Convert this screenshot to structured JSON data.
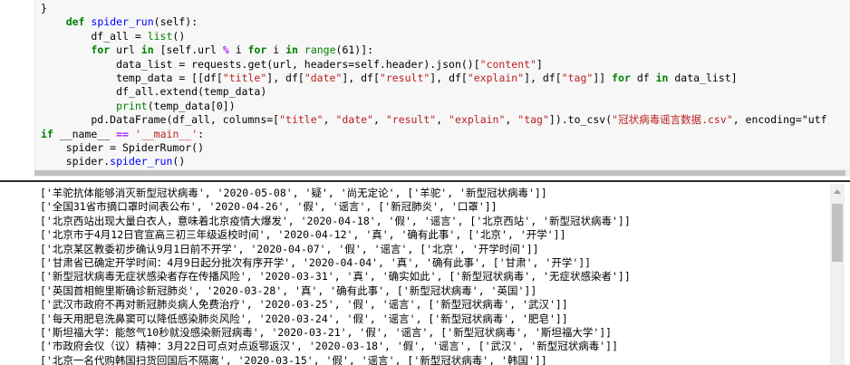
{
  "code": {
    "lines": [
      "}",
      "    def spider_run(self):",
      "        df_all = list()",
      "        for url in [self.url % i for i in range(61)]:",
      "            data_list = requests.get(url, headers=self.header).json()[\"content\"]",
      "            temp_data = [[df[\"title\"], df[\"date\"], df[\"result\"], df[\"explain\"], df[\"tag\"]] for df in data_list]",
      "            df_all.extend(temp_data)",
      "            print(temp_data[0])",
      "        pd.DataFrame(df_all, columns=[\"title\", \"date\", \"result\", \"explain\", \"tag\"]).to_csv(\"冠状病毒谣言数据.csv\", encoding=\"utf",
      "if __name__ == '__main__':",
      "    spider = SpiderRumor()",
      "    spider.spider_run()"
    ]
  },
  "output": {
    "lines": [
      "['羊驼抗体能够消灭新型冠状病毒', '2020-05-08', '疑', '尚无定论', ['羊驼', '新型冠状病毒']]",
      "['全国31省市摘口罩时间表公布', '2020-04-26', '假', '谣言', ['新冠肺炎', '口罩']]",
      "['北京西站出现大量白衣人，意味着北京疫情大爆发', '2020-04-18', '假', '谣言', ['北京西站', '新型冠状病毒']]",
      "['北京市于4月12日官宣高三初三年级返校时间', '2020-04-12', '真', '确有此事', ['北京', '开学']]",
      "['北京某区教委初步确认9月1日前不开学', '2020-04-07', '假', '谣言', ['北京', '开学时间']]",
      "['甘肃省已确定开学时间：4月9日起分批次有序开学', '2020-04-04', '真', '确有此事', ['甘肃', '开学']]",
      "['新型冠状病毒无症状感染者存在传播风险', '2020-03-31', '真', '确实如此', ['新型冠状病毒', '无症状感染者']]",
      "['英国首相鲍里斯确诊新冠肺炎', '2020-03-28', '真', '确有此事', ['新型冠状病毒', '英国']]",
      "['武汉市政府不再对新冠肺炎病人免费治疗', '2020-03-25', '假', '谣言', ['新型冠状病毒', '武汉']]",
      "['每天用肥皂洗鼻窦可以降低感染肺炎风险', '2020-03-24', '假', '谣言', ['新型冠状病毒', '肥皂']]",
      "['斯坦福大学：能憋气10秒就没感染新冠病毒', '2020-03-21', '假', '谣言', ['新型冠状病毒', '斯坦福大学']]",
      "['市政府会仪（议）精神：3月22日可点对点返鄂返汉', '2020-03-18', '假', '谣言', ['武汉', '新型冠状病毒']]",
      "['北京一名代购韩国扫货回国后不隔离', '2020-03-15', '假', '谣言', ['新型冠状病毒', '韩国']]"
    ]
  },
  "colors": {
    "keyword": "#008000",
    "function_name": "#0000ff",
    "string": "#ba2121",
    "operator": "#aa22ff",
    "cell_bg": "#f7f7f7"
  }
}
